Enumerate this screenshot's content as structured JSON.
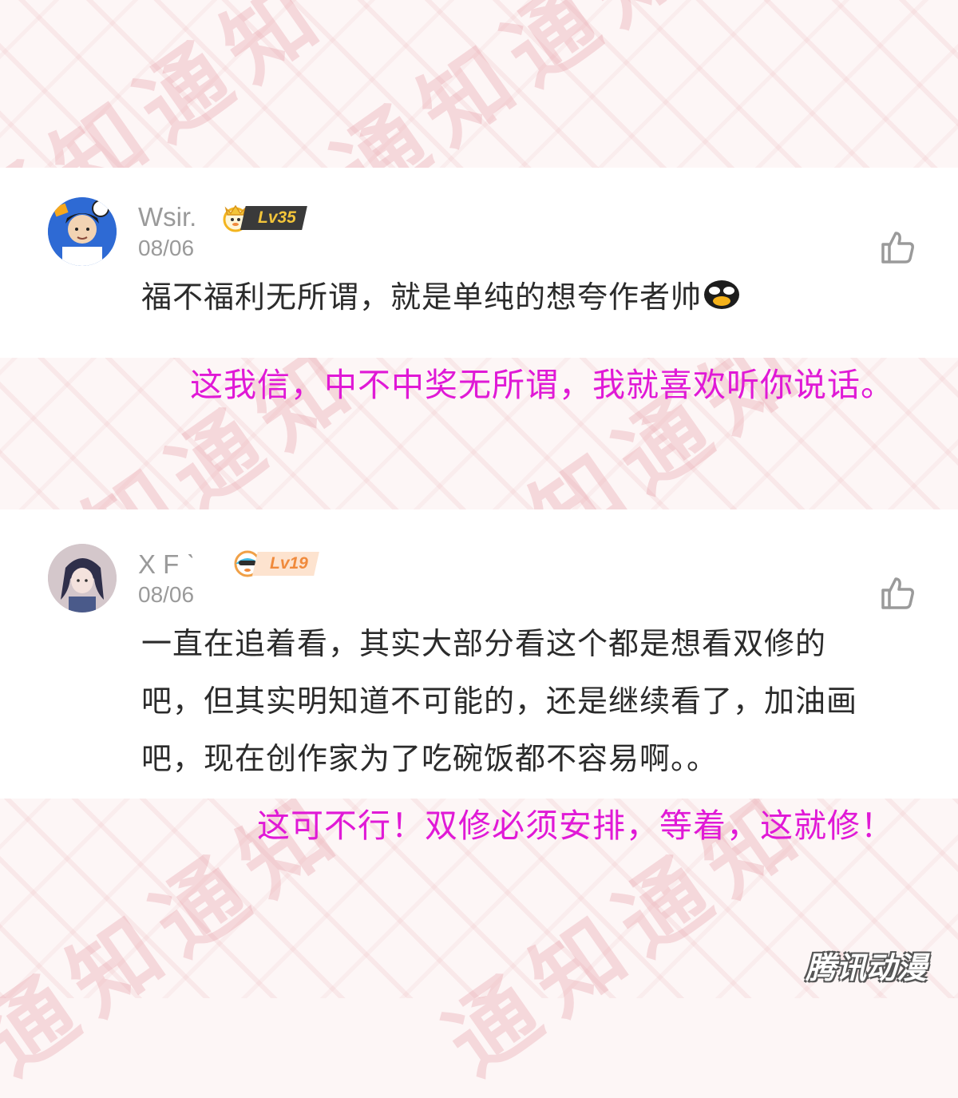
{
  "comments": [
    {
      "username": "Wsir.",
      "level": "Lv35",
      "date": "08/06",
      "text": "福不福利无所谓，就是单纯的想夸作者帅",
      "reply": "这我信，中不中奖无所谓，我就喜欢听你说话。"
    },
    {
      "username": "X F ˋ",
      "level": "Lv19",
      "date": "08/06",
      "text_lines": [
        "一直在追着看，其实大部分看这个都是想看双修的",
        "吧，但其实明知道不可能的，还是继续看了，加油画",
        "吧，现在创作家为了吃碗饭都不容易啊。。"
      ],
      "reply": "这可不行！双修必须安排，等着，这就修！"
    }
  ],
  "watermark": {
    "text": "通知通知"
  },
  "brand": {
    "logo": "腾讯动漫"
  },
  "colors": {
    "reply": "#e019d6",
    "meta": "#9a9a9a",
    "watermark": "#e18c96",
    "badge_lv35_bg": "#3a3a3a",
    "badge_lv35_fg": "#f3c53a",
    "badge_lv19_bg": "#fde3cf",
    "badge_lv19_fg": "#f08a3c"
  }
}
